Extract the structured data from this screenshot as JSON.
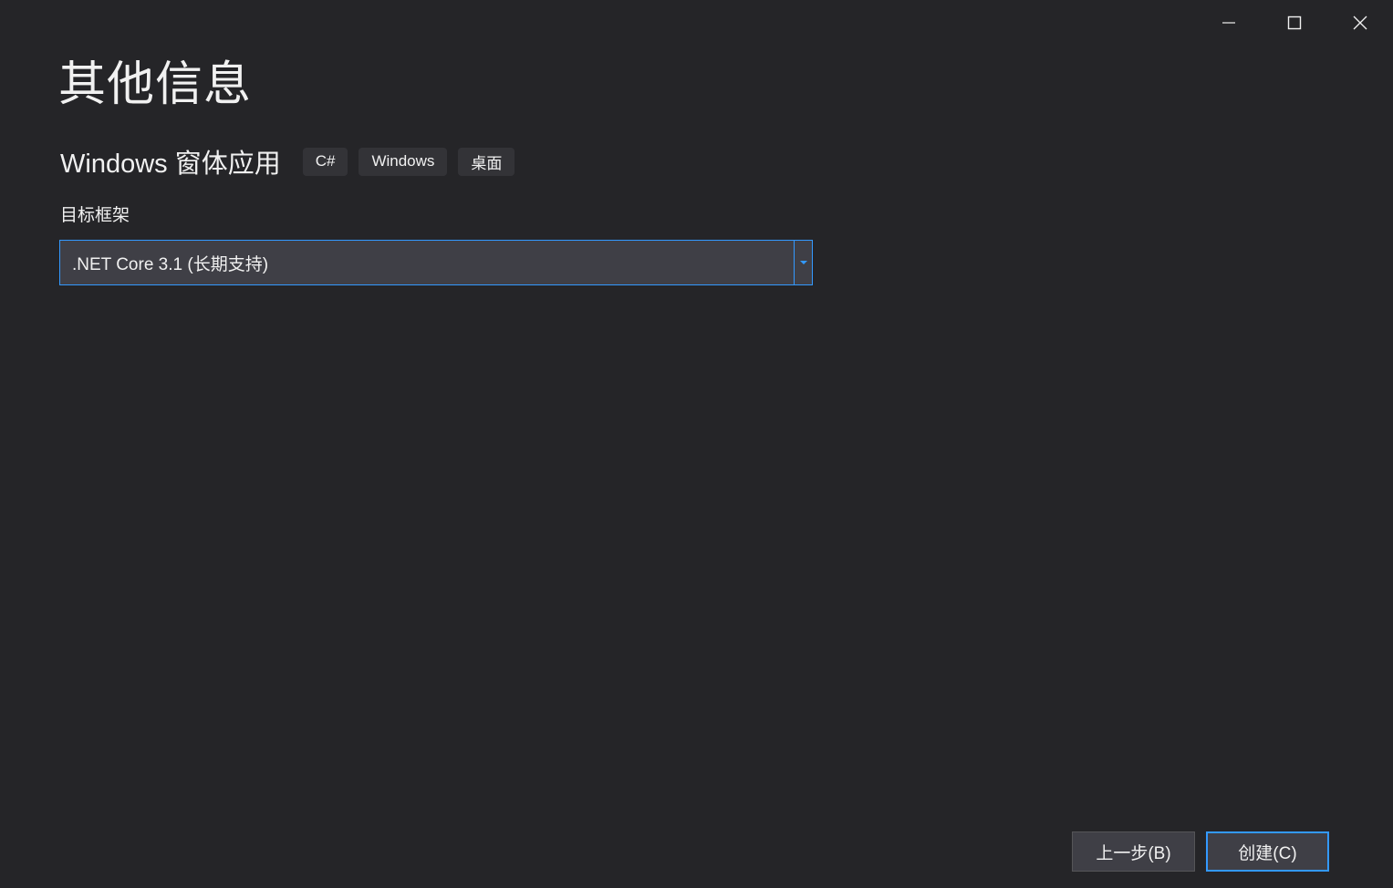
{
  "window": {
    "controls": [
      {
        "name": "minimize-icon",
        "label": "minimize"
      },
      {
        "name": "maximize-icon",
        "label": "maximize"
      },
      {
        "name": "close-icon",
        "label": "close"
      }
    ]
  },
  "page": {
    "title": "其他信息"
  },
  "template": {
    "name": "Windows 窗体应用",
    "tags": [
      "C#",
      "Windows",
      "桌面"
    ]
  },
  "framework": {
    "label": "目标框架",
    "selected": ".NET Core 3.1 (长期支持)"
  },
  "footer": {
    "back_label": "上一步(B)",
    "create_label": "创建(C)"
  },
  "colors": {
    "background": "#252528",
    "accent": "#3399ff",
    "control": "#3f3f46",
    "tag": "#333337",
    "text": "#f1f1f1"
  }
}
